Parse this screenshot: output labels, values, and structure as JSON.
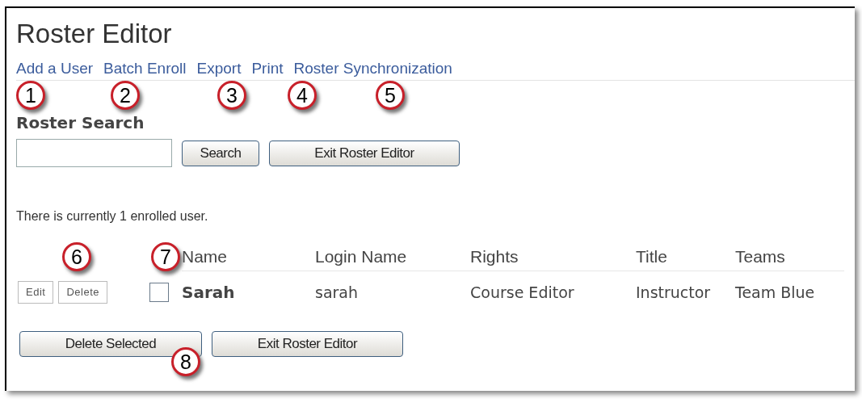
{
  "title": "Roster Editor",
  "nav_links": [
    "Add a User",
    "Batch Enroll",
    "Export",
    "Print",
    "Roster Synchronization"
  ],
  "search": {
    "heading": "Roster Search",
    "buttons": [
      "Search",
      "Exit Roster Editor"
    ]
  },
  "status_text": "There is currently 1 enrolled user.",
  "table": {
    "columns": [
      "Name",
      "Login Name",
      "Rights",
      "Title",
      "Teams"
    ],
    "rows": [
      {
        "actions": [
          "Edit",
          "Delete"
        ],
        "checked": false,
        "cells": [
          "Sarah",
          "sarah",
          "Course Editor",
          "Instructor",
          "Team Blue"
        ]
      }
    ]
  },
  "bottom_buttons": [
    "Delete Selected",
    "Exit Roster Editor"
  ],
  "callouts": [
    "1",
    "2",
    "3",
    "4",
    "5",
    "6",
    "7",
    "8"
  ]
}
